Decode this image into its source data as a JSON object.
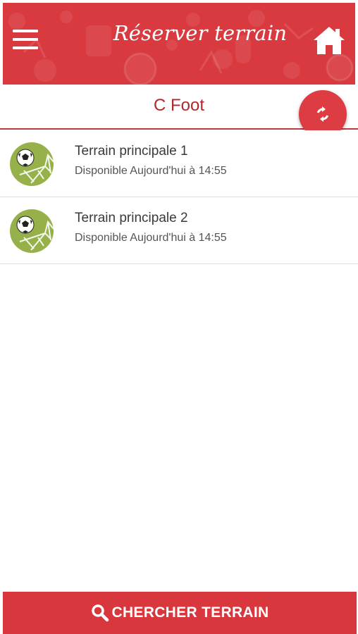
{
  "header": {
    "title": "Réserver terrain",
    "menu_icon": "hamburger-menu-icon",
    "home_icon": "home-icon",
    "background_color": "#d83a3f"
  },
  "section": {
    "title": "C Foot",
    "title_color": "#b3282d",
    "refresh_icon": "refresh-icon"
  },
  "fields": [
    {
      "name": "Terrain principale 1",
      "availability": "Disponible Aujourd'hui à 14:55",
      "icon": "soccer-goal-icon"
    },
    {
      "name": "Terrain principale 2",
      "availability": "Disponible Aujourd'hui à 14:55",
      "icon": "soccer-goal-icon"
    }
  ],
  "footer": {
    "search_label": "CHERCHER TERRAIN",
    "search_icon": "search-icon",
    "accent_color": "#d8373d"
  }
}
